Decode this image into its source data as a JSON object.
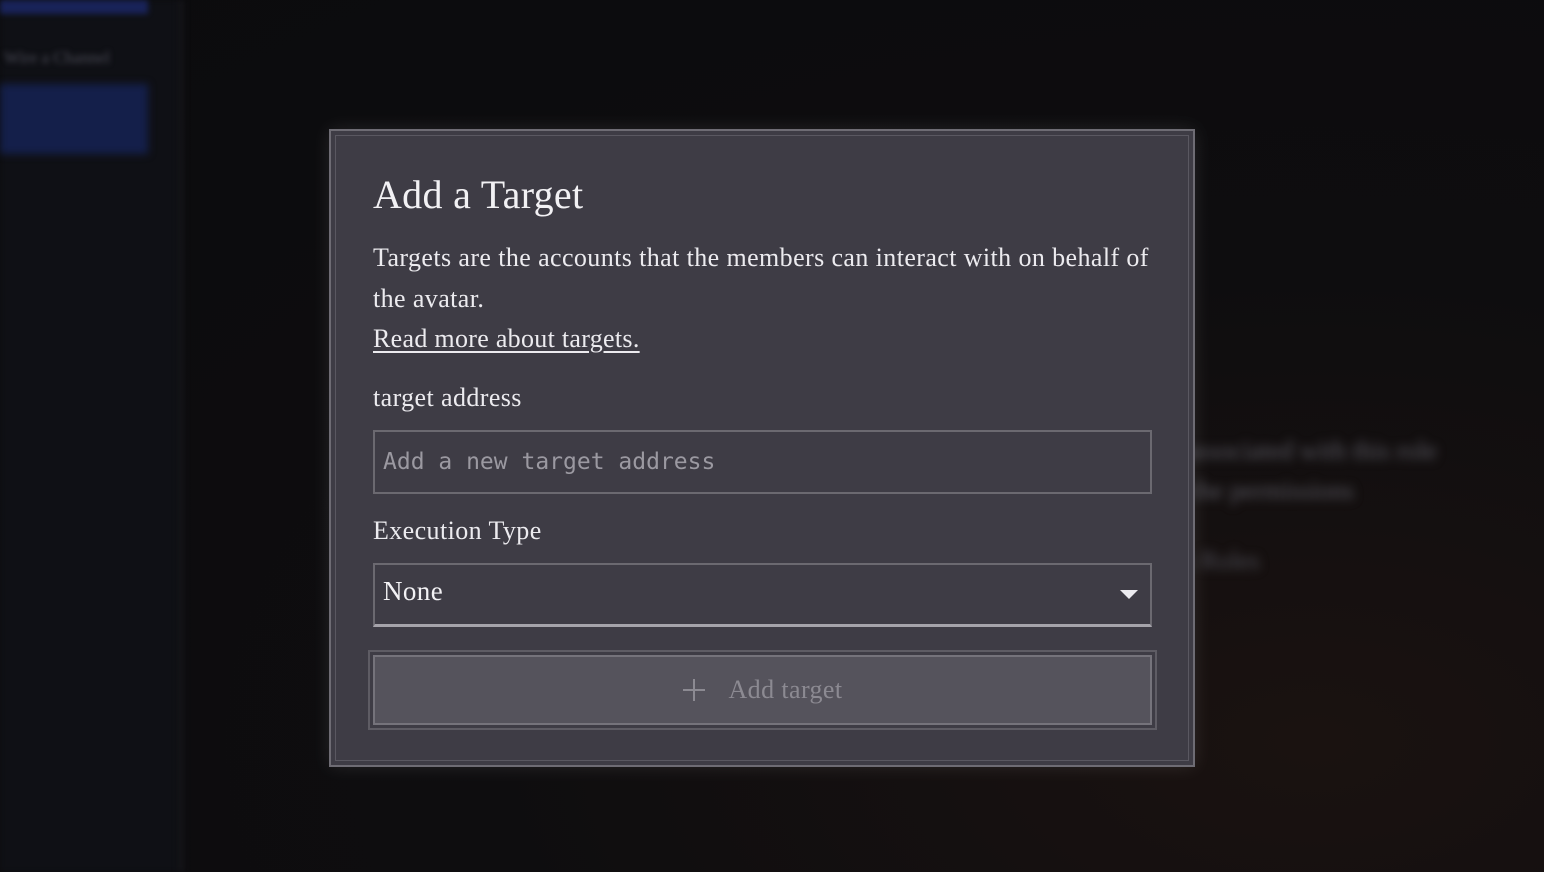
{
  "background": {
    "sidebar_item_text": "Wire a Channel",
    "line1": "No members have permissions associated with this role",
    "line2": "Add a member to this role to configure the permissions",
    "line3": "Go back to Roles"
  },
  "modal": {
    "title": "Add a Target",
    "description": "Targets are the accounts that the members can interact with on behalf of the avatar.",
    "read_more_link": "Read more about targets.",
    "address_label": "target address",
    "address_placeholder": "Add a new target address",
    "address_value": "",
    "execution_label": "Execution Type",
    "execution_selected": "None",
    "add_button_label": "Add target",
    "add_button_icon": "plus-icon"
  },
  "colors": {
    "modal_bg": "#3e3c45",
    "modal_border": "#6e6c74",
    "text_primary": "#ecebef",
    "button_bg": "#55535c",
    "button_text_disabled": "#8c8a92",
    "sidebar_accent": "#141f4a"
  }
}
